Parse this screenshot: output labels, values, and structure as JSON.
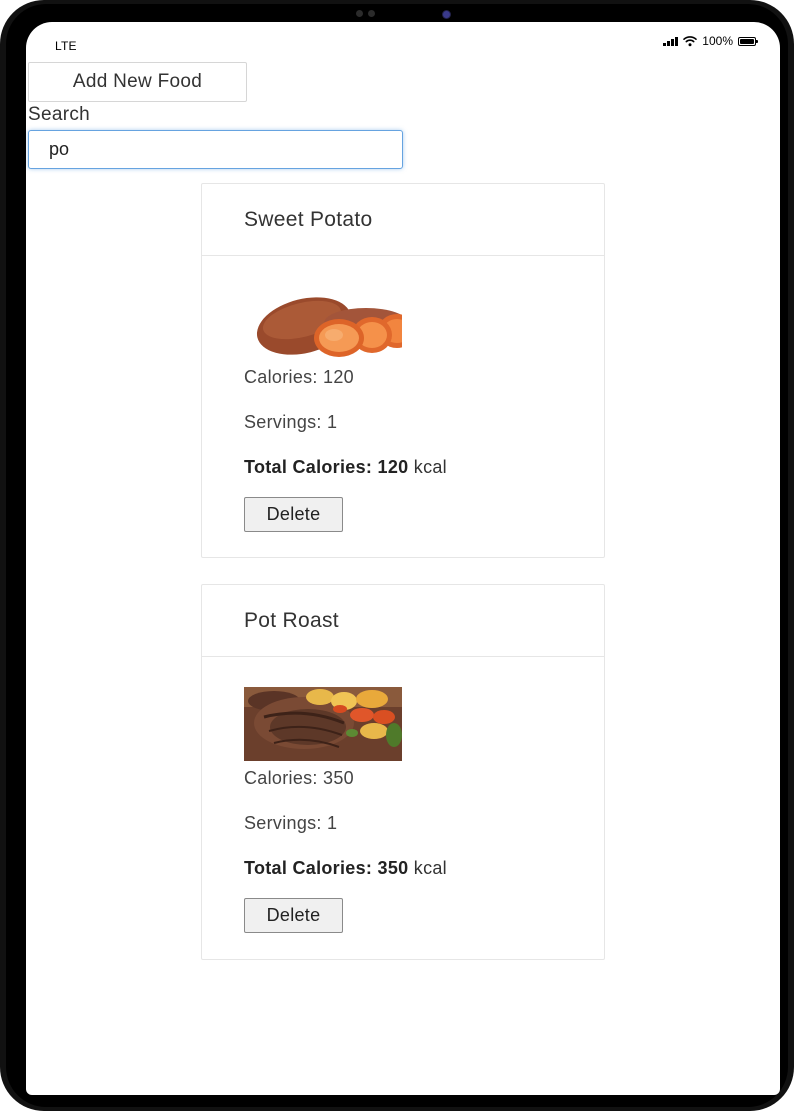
{
  "status_bar": {
    "carrier": "LTE",
    "battery": "100%"
  },
  "toolbar": {
    "add_food_label": "Add New Food"
  },
  "search": {
    "label": "Search",
    "value": "po"
  },
  "foods": [
    {
      "name": "Sweet Potato",
      "image_icon": "sweet-potato-image",
      "calories_text": "Calories: 120",
      "servings_text": "Servings: 1",
      "total_label": "Total Calories:",
      "total_value": "120",
      "total_unit": "kcal",
      "delete_label": "Delete"
    },
    {
      "name": "Pot Roast",
      "image_icon": "pot-roast-image",
      "calories_text": "Calories: 350",
      "servings_text": "Servings: 1",
      "total_label": "Total Calories:",
      "total_value": "350",
      "total_unit": "kcal",
      "delete_label": "Delete"
    }
  ],
  "colors": {
    "focus_border": "#66a3e0",
    "card_border": "#e6e6e6",
    "text": "#333333"
  }
}
